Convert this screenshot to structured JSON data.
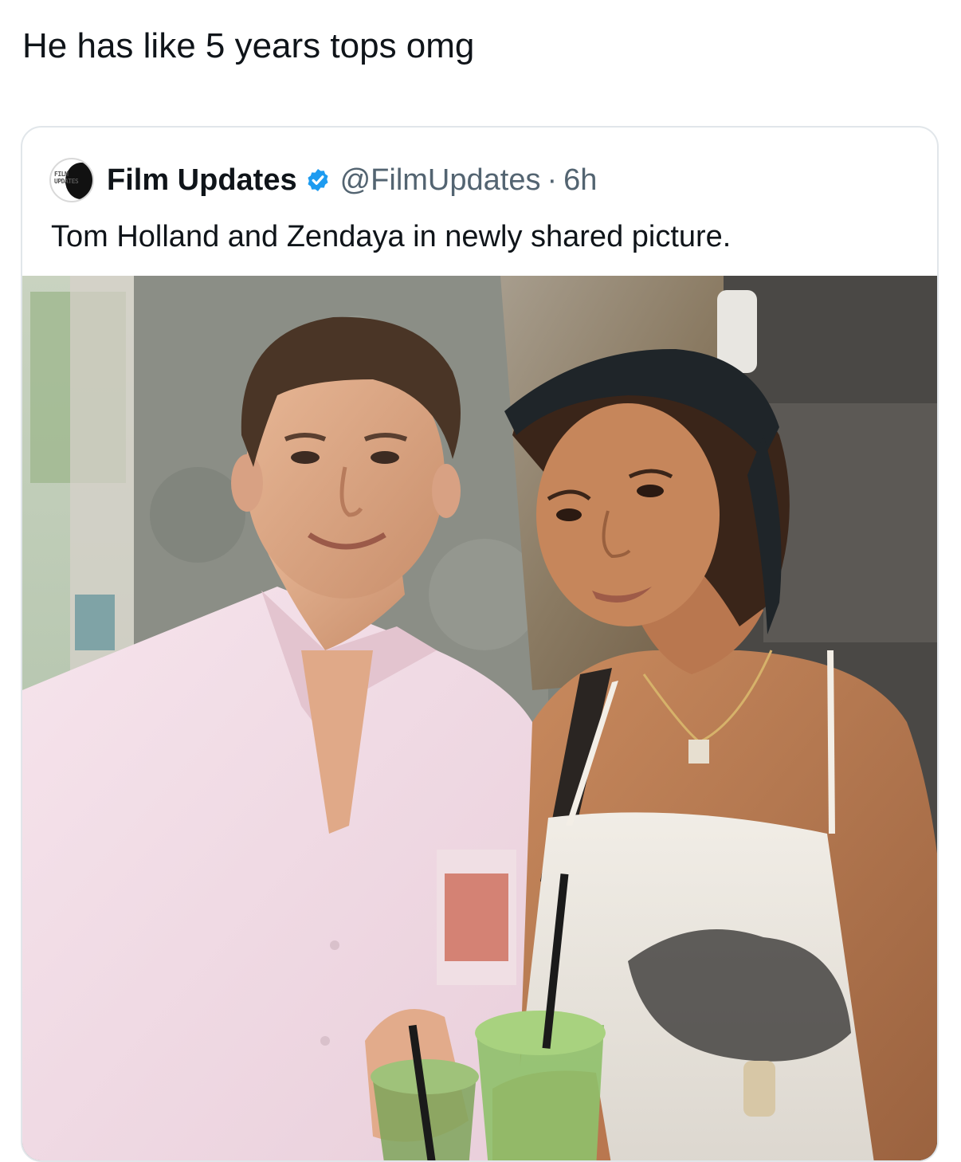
{
  "caption": "He has like 5 years tops omg",
  "quoted_post": {
    "avatar_logo_text": "FILM UPDATES",
    "display_name": "Film Updates",
    "verified": true,
    "handle": "@FilmUpdates",
    "separator": "·",
    "time": "6h",
    "text": "Tom Holland and Zendaya in newly shared picture."
  },
  "icons": {
    "verified": "verified-check-icon",
    "avatar": "film-updates-logo-icon"
  },
  "colors": {
    "verified_blue": "#1d9bf0",
    "secondary_text": "#536471",
    "primary_text": "#0f1419",
    "card_border": "#e1e6ea"
  }
}
